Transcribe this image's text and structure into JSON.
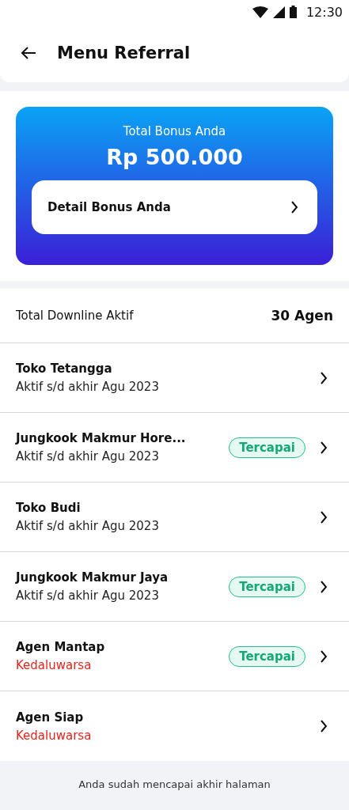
{
  "status_bar": {
    "time": "12:30"
  },
  "header": {
    "title": "Menu Referral"
  },
  "bonus": {
    "label": "Total Bonus Anda",
    "amount": "Rp 500.000",
    "detail_button": "Detail Bonus Anda"
  },
  "summary": {
    "label": "Total Downline Aktif",
    "value": "30 Agen"
  },
  "agents": [
    {
      "name": "Toko Tetangga",
      "status": "Aktif s/d akhir Agu 2023",
      "kind": "active"
    },
    {
      "name": "Jungkook Makmur Hore...",
      "status": "Aktif s/d akhir Agu 2023",
      "kind": "active",
      "badge": "Tercapai"
    },
    {
      "name": "Toko Budi",
      "status": "Aktif s/d akhir Agu 2023",
      "kind": "active"
    },
    {
      "name": "Jungkook Makmur Jaya",
      "status": "Aktif s/d akhir Agu 2023",
      "kind": "active",
      "badge": "Tercapai"
    },
    {
      "name": "Agen Mantap",
      "status": "Kedaluwarsa",
      "kind": "expired",
      "badge": "Tercapai"
    },
    {
      "name": "Agen Siap",
      "status": "Kedaluwarsa",
      "kind": "expired"
    }
  ],
  "footer": "Anda sudah mencapai akhir halaman"
}
